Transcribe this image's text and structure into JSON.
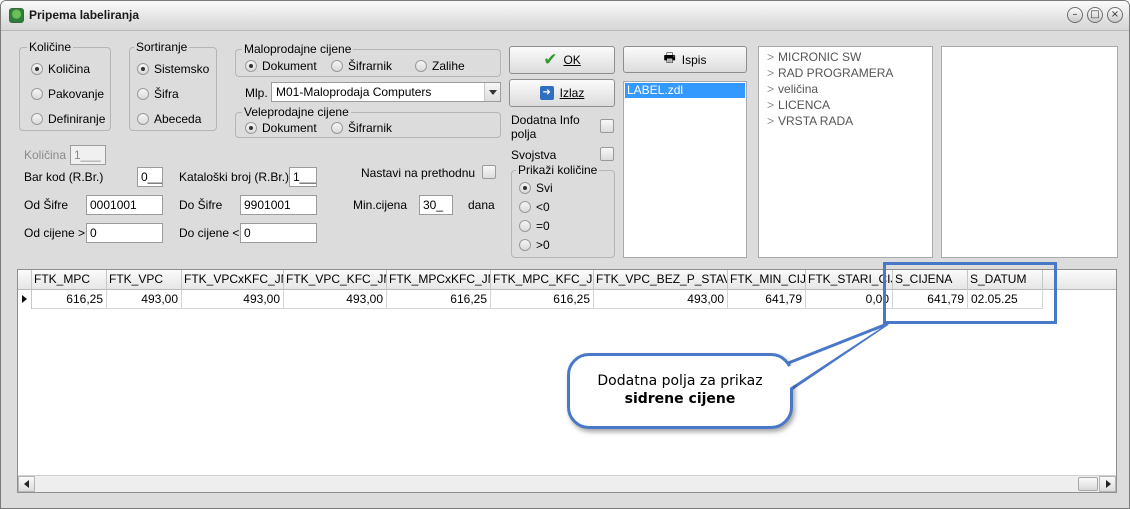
{
  "window": {
    "title": "Pripema labeliranja"
  },
  "kolicine": {
    "legend": "Količine",
    "options": [
      "Količina",
      "Pakovanje",
      "Definiranje"
    ],
    "selected": 0
  },
  "sortiranje": {
    "legend": "Sortiranje",
    "options": [
      "Sistemsko",
      "Šifra",
      "Abeceda"
    ],
    "selected": 0
  },
  "maloprodajne": {
    "legend": "Maloprodajne cijene",
    "options": [
      "Dokument",
      "Šifrarnik",
      "Zalihe"
    ],
    "selected": 0,
    "mlp_label": "Mlp.",
    "mlp_value": "M01-Maloprodaja Computers"
  },
  "veleprodajne": {
    "legend": "Veleprodajne cijene",
    "options": [
      "Dokument",
      "Šifrarnik"
    ],
    "selected": 0
  },
  "buttons": {
    "ok": "OK",
    "izlaz": "Izlaz",
    "ispis": "Ispis"
  },
  "label_list": {
    "items": [
      "LABEL.zdl"
    ]
  },
  "dodatna_info": {
    "label": "Dodatna Info polja",
    "label_line1": "Dodatna Info",
    "label_line2": "polja",
    "checked": false
  },
  "svojstva": {
    "label": "Svojstva",
    "checked": false
  },
  "prikazi_kolicine": {
    "legend": "Prikaži količine",
    "options": [
      "Svi",
      "<0",
      "=0",
      ">0"
    ],
    "selected": 0
  },
  "tree": {
    "items": [
      "MICRONIC SW",
      "RAD PROGRAMERA",
      "veličina",
      "LICENCA",
      "VRSTA RADA"
    ]
  },
  "form": {
    "kolicina_label": "Količina",
    "kolicina_value": "1___",
    "barkod_label": "Bar kod (R.Br.)",
    "barkod_value": "0___",
    "katbroj_label": "Kataloški broj (R.Br.)",
    "katbroj_value": "1___",
    "nastavi_label": "Nastavi na prethodnu",
    "nastavi_checked": false,
    "od_sifre_label": "Od Šifre",
    "od_sifre_value": "0001001",
    "do_sifre_label": "Do Šifre",
    "do_sifre_value": "9901001",
    "min_cijena_label": "Min.cijena",
    "min_cijena_value": "30_",
    "min_cijena_unit": "dana",
    "od_cijene_label": "Od cijene >",
    "od_cijene_value": "0",
    "do_cijene_label": "Do cijene <",
    "do_cijene_value": "0"
  },
  "grid": {
    "columns": [
      "FTK_MPC",
      "FTK_VPC",
      "FTK_VPCxKFC_JM",
      "FTK_VPC_KFC_JM",
      "FTK_MPCxKFC_JM",
      "FTK_MPC_KFC_JM",
      "FTK_VPC_BEZ_P_STAV",
      "FTK_MIN_CIJ",
      "FTK_STARI_CIJ",
      "S_CIJENA",
      "S_DATUM"
    ],
    "rows": [
      [
        "616,25",
        "493,00",
        "493,00",
        "493,00",
        "616,25",
        "616,25",
        "493,00",
        "641,79",
        "0,00",
        "641,79",
        "02.05.25"
      ]
    ]
  },
  "callout": {
    "line1": "Dodatna polja za prikaz",
    "line2": "sidrene cijene"
  },
  "colors": {
    "accent": "#4a78c9",
    "selection": "#3399ff",
    "window_bg": "#dcdcdc"
  }
}
